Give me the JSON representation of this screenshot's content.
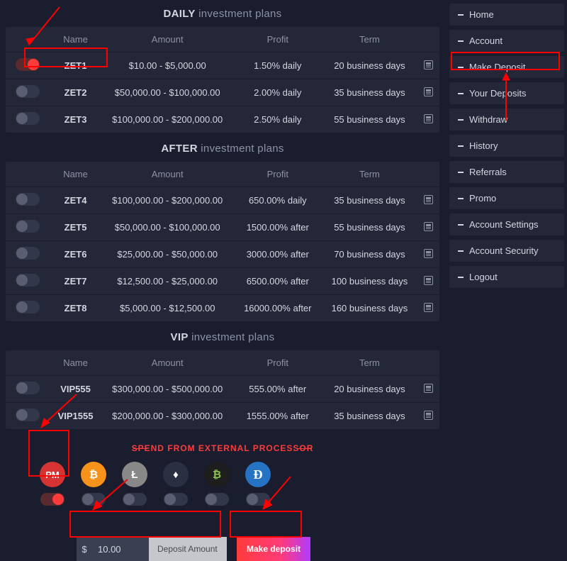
{
  "sections": {
    "daily": {
      "title_bold": "DAILY",
      "title_rest": "investment plans",
      "headers": [
        "Name",
        "Amount",
        "Profit",
        "Term"
      ],
      "rows": [
        {
          "name": "ZET1",
          "amount": "$10.00 - $5,000.00",
          "profit": "1.50% daily",
          "term": "20 business days",
          "on": true
        },
        {
          "name": "ZET2",
          "amount": "$50,000.00 - $100,000.00",
          "profit": "2.00% daily",
          "term": "35 business days",
          "on": false
        },
        {
          "name": "ZET3",
          "amount": "$100,000.00 - $200,000.00",
          "profit": "2.50% daily",
          "term": "55 business days",
          "on": false
        }
      ]
    },
    "after": {
      "title_bold": "AFTER",
      "title_rest": "investment plans",
      "headers": [
        "Name",
        "Amount",
        "Profit",
        "Term"
      ],
      "rows": [
        {
          "name": "ZET4",
          "amount": "$100,000.00 - $200,000.00",
          "profit": "650.00% daily",
          "term": "35 business days",
          "on": false
        },
        {
          "name": "ZET5",
          "amount": "$50,000.00 - $100,000.00",
          "profit": "1500.00% after",
          "term": "55 business days",
          "on": false
        },
        {
          "name": "ZET6",
          "amount": "$25,000.00 - $50,000.00",
          "profit": "3000.00% after",
          "term": "70 business days",
          "on": false
        },
        {
          "name": "ZET7",
          "amount": "$12,500.00 - $25,000.00",
          "profit": "6500.00% after",
          "term": "100 business days",
          "on": false
        },
        {
          "name": "ZET8",
          "amount": "$5,000.00 - $12,500.00",
          "profit": "16000.00% after",
          "term": "160 business days",
          "on": false
        }
      ]
    },
    "vip": {
      "title_bold": "VIP",
      "title_rest": "investment plans",
      "headers": [
        "Name",
        "Amount",
        "Profit",
        "Term"
      ],
      "rows": [
        {
          "name": "VIP555",
          "amount": "$300,000.00 - $500,000.00",
          "profit": "555.00% after",
          "term": "20 business days",
          "on": false
        },
        {
          "name": "VIP1555",
          "amount": "$200,000.00 - $300,000.00",
          "profit": "1555.00% after",
          "term": "35 business days",
          "on": false
        }
      ]
    }
  },
  "sidebar": [
    "Home",
    "Account",
    "Make Deposit",
    "Your Deposits",
    "Withdraw",
    "History",
    "Referrals",
    "Promo",
    "Account Settings",
    "Account Security",
    "Logout"
  ],
  "ext": {
    "title": "SPEND FROM EXTERNAL PROCESSOR",
    "coins": [
      {
        "id": "pm",
        "label": "PM",
        "cls": "pm",
        "on": true
      },
      {
        "id": "btc",
        "label": "₿",
        "cls": "btc",
        "on": false
      },
      {
        "id": "ltc",
        "label": "Ł",
        "cls": "ltc",
        "on": false
      },
      {
        "id": "eth",
        "label": "♦",
        "cls": "eth",
        "on": false
      },
      {
        "id": "bch",
        "label": "₿",
        "cls": "bch",
        "on": false
      },
      {
        "id": "dash",
        "label": "Đ",
        "cls": "dash",
        "on": false
      }
    ]
  },
  "deposit": {
    "currency": "$",
    "amount": "10.00",
    "label": "Deposit Amount",
    "button": "Make deposit"
  }
}
